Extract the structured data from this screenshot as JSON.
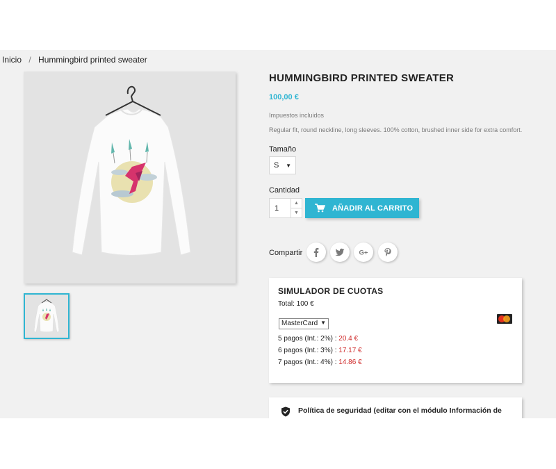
{
  "breadcrumb": {
    "home": "Inicio",
    "separator": "/",
    "current": "Hummingbird printed sweater"
  },
  "product": {
    "title": "HUMMINGBIRD PRINTED SWEATER",
    "price": "100,00 €",
    "tax_note": "Impuestos incluidos",
    "description": "Regular fit, round neckline, long sleeves. 100% cotton, brushed inner side for extra comfort.",
    "size_label": "Tamaño",
    "size_value": "S",
    "quantity_label": "Cantidad",
    "quantity_value": "1",
    "add_to_cart": "AÑADIR AL CARRITO",
    "share_label": "Compartir",
    "social_icons": [
      "facebook-icon",
      "twitter-icon",
      "googleplus-icon",
      "pinterest-icon"
    ]
  },
  "simulator": {
    "title": "SIMULADOR DE CUOTAS",
    "total": "Total: 100 €",
    "card_selected": "MasterCard",
    "installments": [
      {
        "label": "5 pagos (Int.: 2%) : ",
        "amount": "20.4 €"
      },
      {
        "label": "6 pagos (Int.: 3%) : ",
        "amount": "17.17 €"
      },
      {
        "label": "7 pagos (Int.: 4%) : ",
        "amount": "14.86 €"
      }
    ]
  },
  "reassurance": {
    "security": "Política de seguridad (editar con el módulo Información de"
  },
  "colors": {
    "accent": "#2fb5d2",
    "installment_amount": "#cf2a2a",
    "text": "#232323",
    "muted": "#7a7a7a"
  }
}
